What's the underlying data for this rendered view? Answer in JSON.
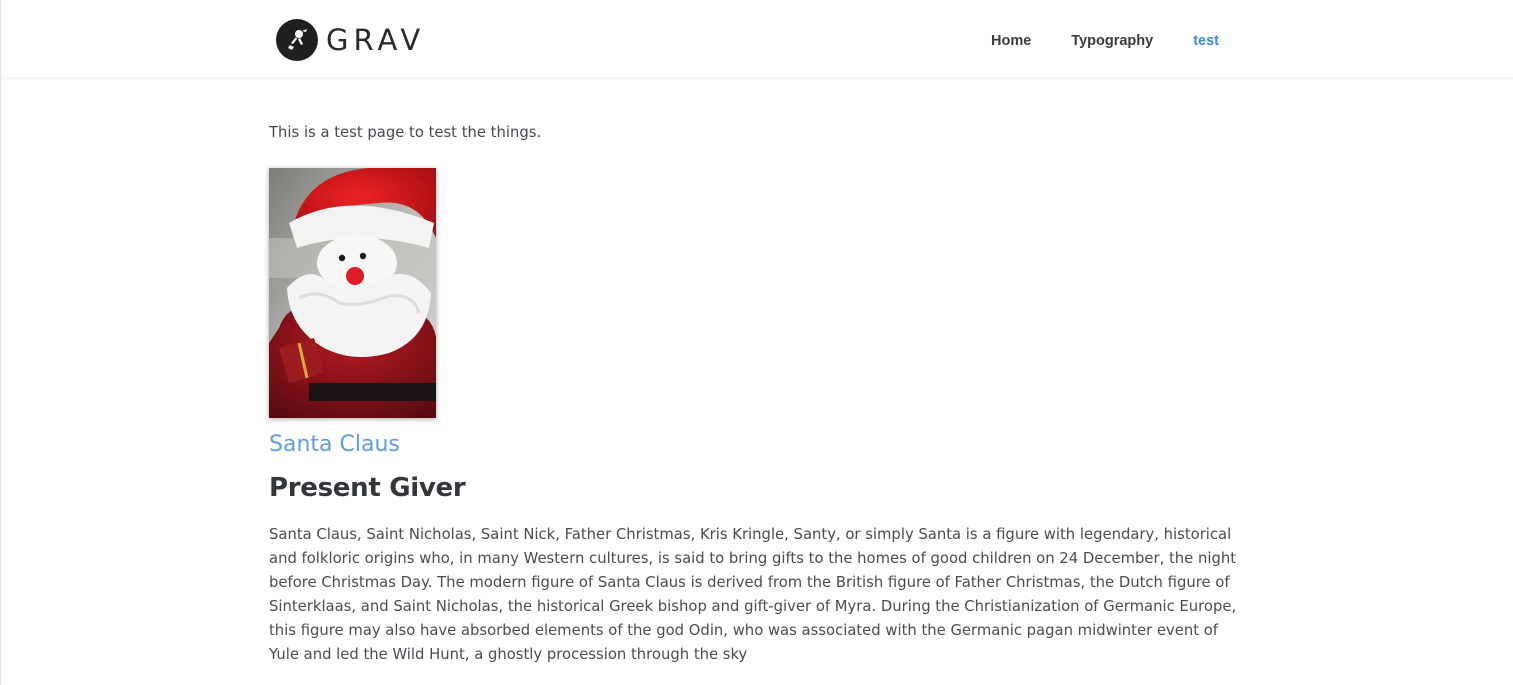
{
  "header": {
    "logo_text": "GRAV",
    "nav": [
      {
        "label": "Home",
        "active": false
      },
      {
        "label": "Typography",
        "active": false
      },
      {
        "label": "test",
        "active": true
      }
    ]
  },
  "main": {
    "intro": "This is a test page to test the things.",
    "image": {
      "alt": "Santa Claus figurine",
      "icon": "santa-photo"
    },
    "caption": "Santa Claus",
    "heading": "Present Giver",
    "body": "Santa Claus, Saint Nicholas, Saint Nick, Father Christmas, Kris Kringle, Santy, or simply Santa is a figure with legendary, historical and folkloric origins who, in many Western cultures, is said to bring gifts to the homes of good children on 24 December, the night before Christmas Day. The modern figure of Santa Claus is derived from the British figure of Father Christmas, the Dutch figure of Sinterklaas, and Saint Nicholas, the historical Greek bishop and gift-giver of Myra. During the Christianization of Germanic Europe, this figure may also have absorbed elements of the god Odin, who was associated with the Germanic pagan midwinter event of Yule and led the Wild Hunt, a ghostly procession through the sky"
  },
  "colors": {
    "accent": "#3d8be0",
    "caption": "#5d9ce6",
    "text": "#4a4c52",
    "heading": "#33363b"
  }
}
